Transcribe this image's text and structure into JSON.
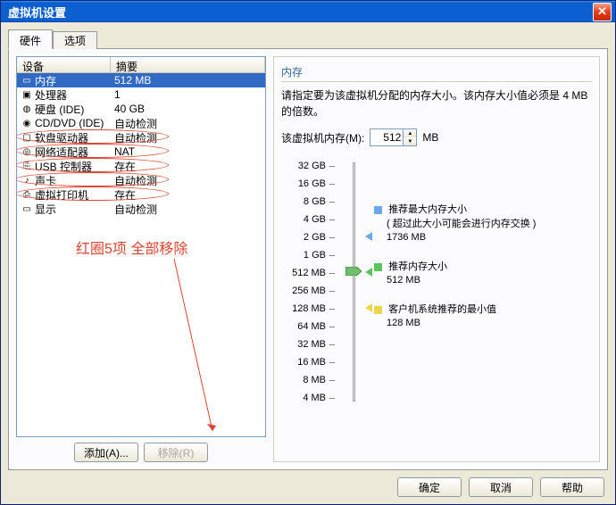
{
  "window": {
    "title": "虚拟机设置"
  },
  "tabs": {
    "hardware": "硬件",
    "options": "选项"
  },
  "table": {
    "head_device": "设备",
    "head_summary": "摘要",
    "rows": [
      {
        "icon": "mem",
        "name": "内存",
        "summary": "512 MB",
        "selected": true,
        "circled": false
      },
      {
        "icon": "cpu",
        "name": "处理器",
        "summary": "1",
        "circled": false
      },
      {
        "icon": "hdd",
        "name": "硬盘 (IDE)",
        "summary": "40 GB",
        "circled": false
      },
      {
        "icon": "cd",
        "name": "CD/DVD (IDE)",
        "summary": "自动检测",
        "circled": false
      },
      {
        "icon": "floppy",
        "name": "软盘驱动器",
        "summary": "自动检测",
        "circled": true
      },
      {
        "icon": "net",
        "name": "网络适配器",
        "summary": "NAT",
        "circled": true
      },
      {
        "icon": "usb",
        "name": "USB 控制器",
        "summary": "存在",
        "circled": true
      },
      {
        "icon": "sound",
        "name": "声卡",
        "summary": "自动检测",
        "circled": true
      },
      {
        "icon": "printer",
        "name": "虚拟打印机",
        "summary": "存在",
        "circled": true
      },
      {
        "icon": "display",
        "name": "显示",
        "summary": "自动检测",
        "circled": false
      }
    ]
  },
  "buttons": {
    "add": "添加(A)...",
    "remove": "移除(R)",
    "ok": "确定",
    "cancel": "取消",
    "help": "帮助"
  },
  "mem": {
    "title": "内存",
    "desc": "请指定要为该虚拟机分配的内存大小。该内存大小值必须是 4 MB 的倍数。",
    "label": "该虚拟机内存(M):",
    "value": "512",
    "unit": "MB",
    "ticks": [
      "32 GB",
      "16 GB",
      "8 GB",
      "4 GB",
      "2 GB",
      "1 GB",
      "512 MB",
      "256 MB",
      "128 MB",
      "64 MB",
      "32 MB",
      "16 MB",
      "8 MB",
      "4 MB"
    ],
    "legend": {
      "max_label": "推荐最大内存大小",
      "max_note": "( 超过此大小可能会进行内存交换 )",
      "max_val": "1736 MB",
      "rec_label": "推荐内存大小",
      "rec_val": "512 MB",
      "min_label": "客户机系统推荐的最小值",
      "min_val": "128 MB"
    }
  },
  "annotation": {
    "text": "红圈5项 全部移除"
  }
}
